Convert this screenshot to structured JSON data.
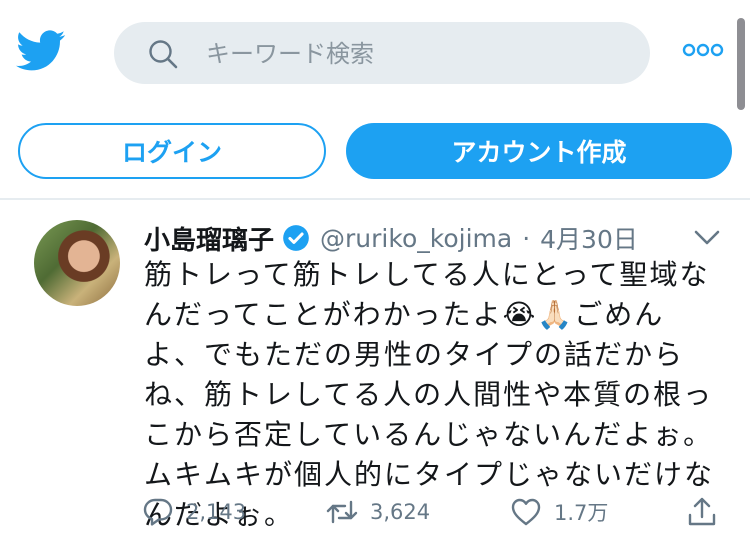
{
  "header": {
    "logo_icon": "twitter-bird-icon",
    "search": {
      "placeholder": "キーワード検索",
      "icon": "search-icon"
    },
    "more_icon": "more-dots-icon",
    "brand_color": "#1da1f2"
  },
  "auth": {
    "login_label": "ログイン",
    "signup_label": "アカウント作成"
  },
  "tweet": {
    "display_name": "小島瑠璃子",
    "verified_icon": "verified-badge-icon",
    "handle": "@ruriko_kojima",
    "separator": "·",
    "date": "4月30日",
    "text": {
      "part1": "筋トレって筋トレしてる人にとって聖域なんだってことがわかったよ",
      "emoji": "😭🙏🏻",
      "part2": "ごめんよ、でもただの男性のタイプの話だからね、筋トレしてる人の人間性や本質の根っこから否定しているんじゃないんだよぉ。ムキムキが個人的にタイプじゃないだけなんだよぉ。"
    },
    "actions": {
      "reply_count": "2,143",
      "retweet_count": "3,624",
      "like_count": "1.7万"
    }
  }
}
